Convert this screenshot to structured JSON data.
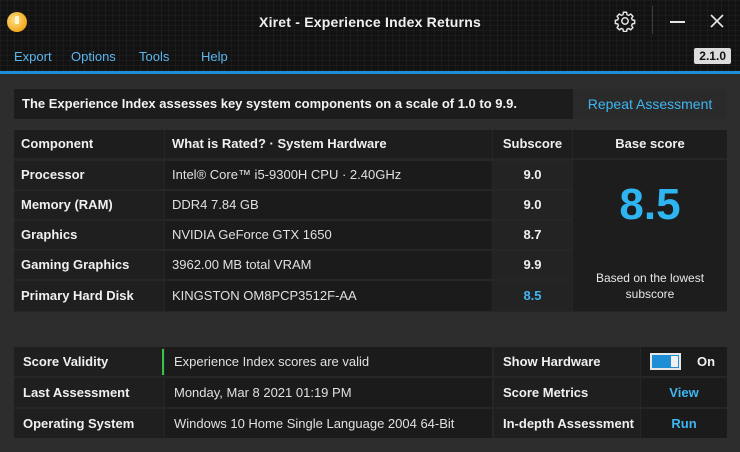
{
  "window": {
    "title": "Xiret - Experience Index Returns",
    "icons": {
      "app": "app-logo-icon",
      "settings": "gear-icon",
      "minimize": "minimize-icon",
      "close": "close-icon"
    }
  },
  "menu": {
    "items": [
      "Export",
      "Options",
      "Tools",
      "Help"
    ],
    "version": "2.1.0"
  },
  "info": {
    "text": "The Experience Index assesses key system components on a scale of 1.0 to 9.9.",
    "repeat_button": "Repeat Assessment"
  },
  "table": {
    "headers": {
      "component": "Component",
      "hardware": "What is Rated? · System Hardware",
      "subscore": "Subscore",
      "base": "Base score"
    },
    "rows": [
      {
        "component": "Processor",
        "hardware": "Intel® Core™ i5-9300H CPU · 2.40GHz",
        "subscore": "9.0"
      },
      {
        "component": "Memory (RAM)",
        "hardware": "DDR4 7.84 GB",
        "subscore": "9.0"
      },
      {
        "component": "Graphics",
        "hardware": "NVIDIA GeForce GTX 1650",
        "subscore": "8.7"
      },
      {
        "component": "Gaming Graphics",
        "hardware": "3962.00 MB total VRAM",
        "subscore": "9.9"
      },
      {
        "component": "Primary Hard Disk",
        "hardware": "KINGSTON OM8PCP3512F-AA",
        "subscore": "8.5"
      }
    ],
    "base_score": "8.5",
    "base_note": "Based on the lowest subscore"
  },
  "details": {
    "validity_label": "Score Validity",
    "validity_value": "Experience Index scores are valid",
    "last_label": "Last Assessment",
    "last_value": "Monday, Mar 8 2021 01:19 PM",
    "os_label": "Operating System",
    "os_value": "Windows 10 Home Single Language 2004 64-Bit",
    "show_hw_label": "Show Hardware",
    "show_hw_state": "On",
    "metrics_label": "Score Metrics",
    "metrics_link": "View",
    "indepth_label": "In-depth Assessment",
    "indepth_link": "Run"
  },
  "colors": {
    "accent": "#1e8fd6",
    "link": "#3fb6f2",
    "valid": "#39c24a"
  }
}
